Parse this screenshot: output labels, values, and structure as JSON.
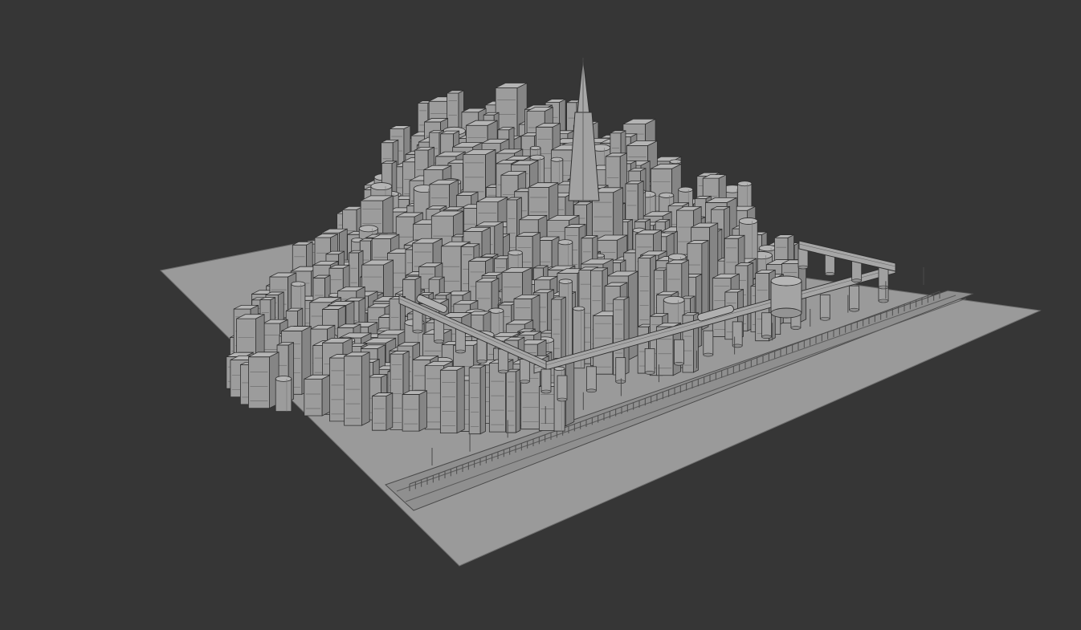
{
  "viewport": {
    "background_color": "#363636",
    "shading": "solid-gray-clay",
    "subject": "city-model"
  },
  "scene_colors": {
    "ground": "#9a9a9a",
    "ground_edge": "#7e7e7e",
    "building_front": "#9c9c9c",
    "building_side": "#858585",
    "building_top": "#b4b4b4",
    "outline": "#2e2e2e",
    "window": "#6e6e6e"
  }
}
